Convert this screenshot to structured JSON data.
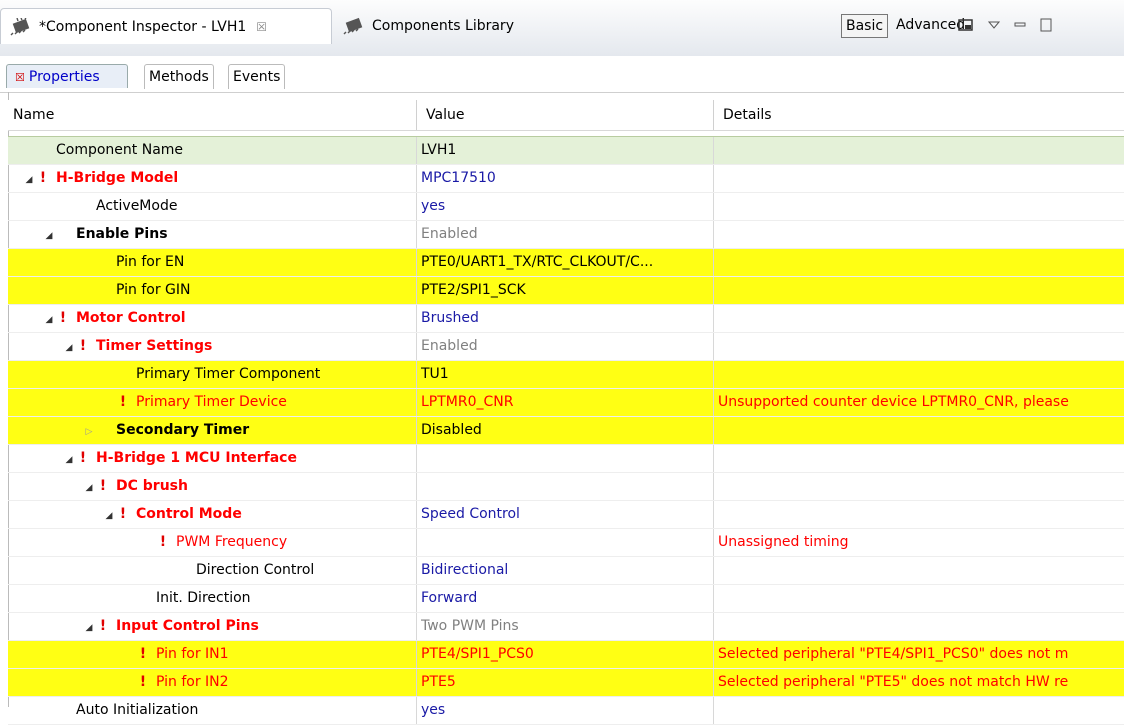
{
  "tabs": {
    "inspector": "*Component Inspector - LVH1",
    "library": "Components Library",
    "close_glyph": "☒"
  },
  "toolbar": {
    "basic": "Basic",
    "advanced": "Advanced"
  },
  "subtabs": {
    "properties": "Properties",
    "methods": "Methods",
    "events": "Events"
  },
  "columns": {
    "name": "Name",
    "value": "Value",
    "details": "Details"
  },
  "rows": [
    {
      "name": "Component Name",
      "value": "LVH1",
      "details": "",
      "indent": 0,
      "expander": "none",
      "err": false,
      "style": "normal",
      "valStyle": "normal",
      "bg": "sel"
    },
    {
      "name": "H-Bridge Model",
      "value": "MPC17510",
      "details": "",
      "indent": 0,
      "expander": "open",
      "err": true,
      "style": "redbold",
      "valStyle": "blue",
      "bg": ""
    },
    {
      "name": "ActiveMode",
      "value": "yes",
      "details": "",
      "indent": 2,
      "expander": "none",
      "err": false,
      "style": "normal",
      "valStyle": "blue",
      "bg": ""
    },
    {
      "name": "Enable Pins",
      "value": "Enabled",
      "details": "",
      "indent": 1,
      "expander": "open",
      "err": false,
      "style": "bold",
      "valStyle": "gray",
      "bg": ""
    },
    {
      "name": "Pin for EN",
      "value": "PTE0/UART1_TX/RTC_CLKOUT/C...",
      "details": "",
      "indent": 3,
      "expander": "none",
      "err": false,
      "style": "normal",
      "valStyle": "normal",
      "bg": "y"
    },
    {
      "name": "Pin for GIN",
      "value": "PTE2/SPI1_SCK",
      "details": "",
      "indent": 3,
      "expander": "none",
      "err": false,
      "style": "normal",
      "valStyle": "normal",
      "bg": "y"
    },
    {
      "name": "Motor Control",
      "value": "Brushed",
      "details": "",
      "indent": 1,
      "expander": "open",
      "err": true,
      "style": "redbold",
      "valStyle": "blue",
      "bg": ""
    },
    {
      "name": "Timer Settings",
      "value": "Enabled",
      "details": "",
      "indent": 2,
      "expander": "open",
      "err": true,
      "style": "redbold",
      "valStyle": "gray",
      "bg": ""
    },
    {
      "name": "Primary Timer Component",
      "value": "TU1",
      "details": "",
      "indent": 4,
      "expander": "none",
      "err": false,
      "style": "normal",
      "valStyle": "normal",
      "bg": "y"
    },
    {
      "name": "Primary Timer Device",
      "value": "LPTMR0_CNR",
      "details": "Unsupported counter device LPTMR0_CNR, please",
      "indent": 4,
      "expander": "none",
      "err": true,
      "style": "red",
      "valStyle": "red",
      "bg": "y"
    },
    {
      "name": "Secondary Timer",
      "value": "Disabled",
      "details": "",
      "indent": 3,
      "expander": "closed",
      "err": false,
      "style": "bold",
      "valStyle": "normal",
      "bg": "y"
    },
    {
      "name": "H-Bridge 1 MCU Interface",
      "value": "",
      "details": "",
      "indent": 2,
      "expander": "open",
      "err": true,
      "style": "redbold",
      "valStyle": "normal",
      "bg": ""
    },
    {
      "name": "DC brush",
      "value": "",
      "details": "",
      "indent": 3,
      "expander": "open",
      "err": true,
      "style": "redbold",
      "valStyle": "normal",
      "bg": ""
    },
    {
      "name": "Control Mode",
      "value": "Speed Control",
      "details": "",
      "indent": 4,
      "expander": "open",
      "err": true,
      "style": "redbold",
      "valStyle": "blue",
      "bg": ""
    },
    {
      "name": "PWM Frequency",
      "value": "",
      "details": "Unassigned timing",
      "indent": 6,
      "expander": "none",
      "err": true,
      "style": "red",
      "valStyle": "normal",
      "bg": ""
    },
    {
      "name": "Direction Control",
      "value": "Bidirectional",
      "details": "",
      "indent": 7,
      "expander": "none",
      "err": false,
      "style": "normal",
      "valStyle": "blue",
      "bg": ""
    },
    {
      "name": "Init. Direction",
      "value": "Forward",
      "details": "",
      "indent": 5,
      "expander": "none",
      "err": false,
      "style": "normal",
      "valStyle": "blue",
      "bg": ""
    },
    {
      "name": "Input Control Pins",
      "value": "Two PWM Pins",
      "details": "",
      "indent": 3,
      "expander": "open",
      "err": true,
      "style": "redbold",
      "valStyle": "gray",
      "bg": ""
    },
    {
      "name": "Pin for IN1",
      "value": "PTE4/SPI1_PCS0",
      "details": "Selected peripheral \"PTE4/SPI1_PCS0\" does not m",
      "indent": 5,
      "expander": "none",
      "err": true,
      "style": "red",
      "valStyle": "red",
      "bg": "y"
    },
    {
      "name": "Pin for IN2",
      "value": "PTE5",
      "details": "Selected peripheral \"PTE5\" does not match HW re",
      "indent": 5,
      "expander": "none",
      "err": true,
      "style": "red",
      "valStyle": "red",
      "bg": "y"
    },
    {
      "name": "Auto Initialization",
      "value": "yes",
      "details": "",
      "indent": 1,
      "expander": "none",
      "err": false,
      "style": "normal",
      "valStyle": "blue",
      "bg": ""
    }
  ]
}
